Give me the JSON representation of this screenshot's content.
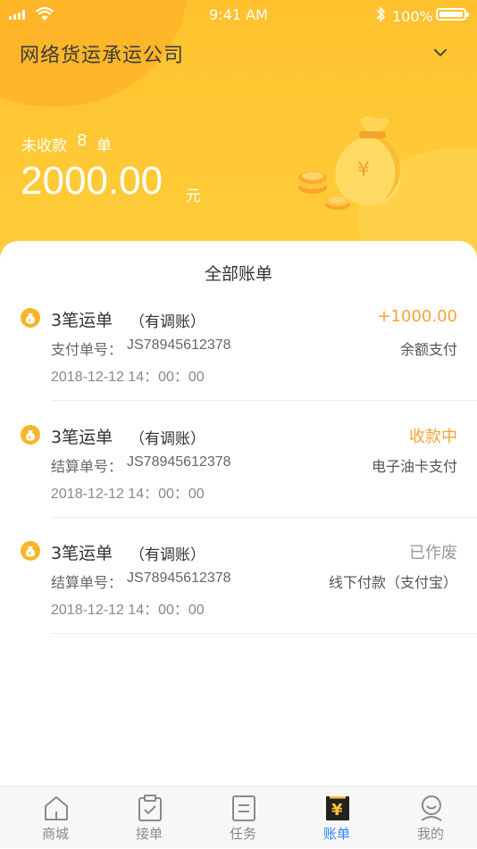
{
  "status_bar": {
    "time": "9:41 AM",
    "battery": "100%"
  },
  "header": {
    "company": "网络货运承运公司",
    "unpaid_label": "未收款",
    "unpaid_count": "8",
    "unpaid_unit": "单",
    "amount": "2000.00",
    "amount_unit": "元"
  },
  "list": {
    "title": "全部账单",
    "items": [
      {
        "title": "3笔运单",
        "note": "（有调账）",
        "status": "+1000.00",
        "status_color": "#f4a533",
        "no_label": "支付单号：",
        "no_value": "JS78945612378",
        "method": "余额支付",
        "time": "2018-12-12  14：00：00"
      },
      {
        "title": "3笔运单",
        "note": "（有调账）",
        "status": "收款中",
        "status_color": "#f4a533",
        "no_label": "结算单号：",
        "no_value": "JS78945612378",
        "method": "电子油卡支付",
        "time": "2018-12-12  14：00：00"
      },
      {
        "title": "3笔运单",
        "note": "（有调账）",
        "status": "已作废",
        "status_color": "#999999",
        "no_label": "结算单号：",
        "no_value": "JS78945612378",
        "method": "线下付款（支付宝）",
        "time": "2018-12-12  14：00：00"
      }
    ]
  },
  "tabbar": {
    "active_color": "#2f86f6",
    "tabs": [
      {
        "label": "商城",
        "icon": "shop-icon"
      },
      {
        "label": "接单",
        "icon": "clipboard-check-icon"
      },
      {
        "label": "任务",
        "icon": "task-list-icon"
      },
      {
        "label": "账单",
        "icon": "bill-yuan-icon"
      },
      {
        "label": "我的",
        "icon": "profile-icon"
      }
    ]
  }
}
